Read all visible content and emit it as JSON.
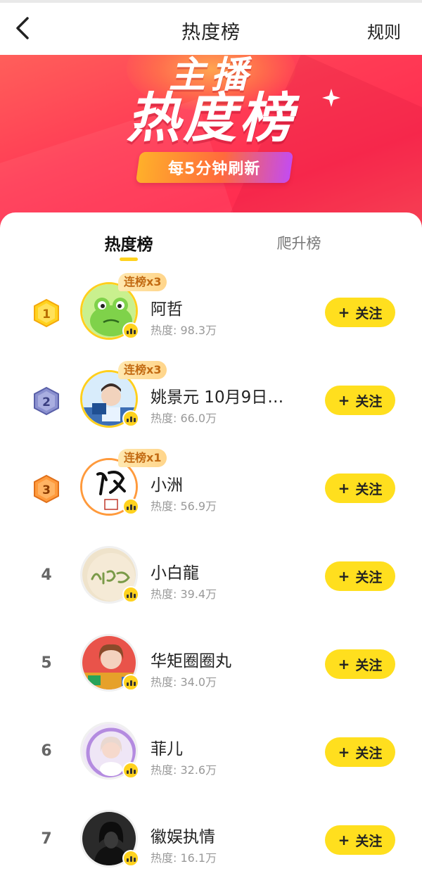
{
  "header": {
    "title": "热度榜",
    "rules_label": "规则"
  },
  "banner": {
    "subtitle": "主播",
    "title": "热度榜",
    "refresh_text": "每5分钟刷新"
  },
  "tabs": [
    {
      "label": "热度榜",
      "active": true
    },
    {
      "label": "爬升榜",
      "active": false
    }
  ],
  "follow_label": "关注",
  "follow_plus": "+",
  "rankings": [
    {
      "rank": "1",
      "name": "阿哲",
      "heat": "热度: 98.3万",
      "streak": "连榜x3",
      "badge_color": "#ffcc1a"
    },
    {
      "rank": "2",
      "name": "姚景元 10月9日…",
      "heat": "热度: 66.0万",
      "streak": "连榜x3",
      "badge_color": "#7f86c6"
    },
    {
      "rank": "3",
      "name": "小洲",
      "heat": "热度: 56.9万",
      "streak": "连榜x1",
      "badge_color": "#ff9a3c"
    },
    {
      "rank": "4",
      "name": "小白龍",
      "heat": "热度: 39.4万",
      "streak": ""
    },
    {
      "rank": "5",
      "name": "华矩圈圈丸",
      "heat": "热度: 34.0万",
      "streak": ""
    },
    {
      "rank": "6",
      "name": "菲儿",
      "heat": "热度: 32.6万",
      "streak": ""
    },
    {
      "rank": "7",
      "name": "徽娱执情",
      "heat": "热度: 16.1万",
      "streak": ""
    }
  ]
}
